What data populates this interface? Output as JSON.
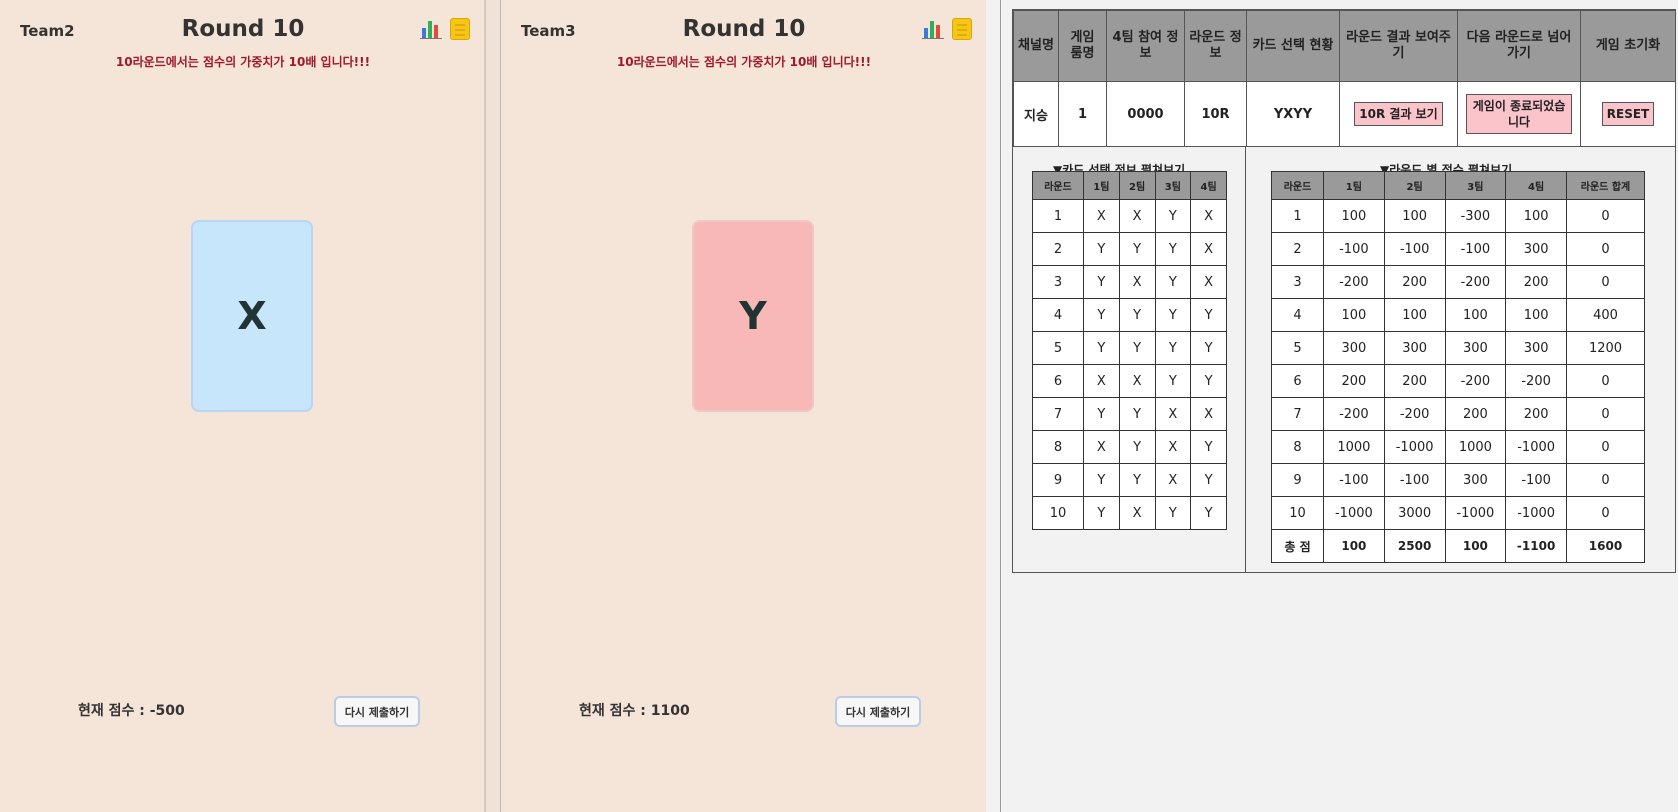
{
  "team2": {
    "name": "Team2",
    "round": "Round 10",
    "notice": "10라운드에서는 점수의 가중치가 10배 입니다!!!",
    "card": "X",
    "score": "현재 점수 : -500",
    "button": "다시 제출하기"
  },
  "team3": {
    "name": "Team3",
    "round": "Round 10",
    "notice": "10라운드에서는 점수의 가중치가 10배 입니다!!!",
    "card": "Y",
    "score": "현재 점수 : 1100",
    "button": "다시 제출하기"
  },
  "admin": {
    "headers": [
      "채널명",
      "게임 룸명",
      "4팀 참여 정보",
      "라운드 정보",
      "카드 선택 현황",
      "라운드 결과 보여주기",
      "다음 라운드로 넘어가기",
      "게임 초기화"
    ],
    "row": {
      "channel": "지승",
      "room": "1",
      "participation": "0000",
      "round": "10R",
      "cards": "YXYY",
      "show_result": "10R 결과 보기",
      "next_round": "게임이 종료되었습니다",
      "reset": "RESET"
    },
    "card_section_title": "▼카드 선택 정보 펼쳐보기",
    "score_section_title": "▼라운드 별 점수 펼쳐보기",
    "card_table": {
      "headers": [
        "라운드",
        "1팀",
        "2팀",
        "3팀",
        "4팀"
      ],
      "rows": [
        [
          "1",
          "X",
          "X",
          "Y",
          "X"
        ],
        [
          "2",
          "Y",
          "Y",
          "Y",
          "X"
        ],
        [
          "3",
          "Y",
          "X",
          "Y",
          "X"
        ],
        [
          "4",
          "Y",
          "Y",
          "Y",
          "Y"
        ],
        [
          "5",
          "Y",
          "Y",
          "Y",
          "Y"
        ],
        [
          "6",
          "X",
          "X",
          "Y",
          "Y"
        ],
        [
          "7",
          "Y",
          "Y",
          "X",
          "X"
        ],
        [
          "8",
          "X",
          "Y",
          "X",
          "Y"
        ],
        [
          "9",
          "Y",
          "Y",
          "X",
          "Y"
        ],
        [
          "10",
          "Y",
          "X",
          "Y",
          "Y"
        ]
      ]
    },
    "score_table": {
      "headers": [
        "라운드",
        "1팀",
        "2팀",
        "3팀",
        "4팀",
        "라운드 합계"
      ],
      "rows": [
        [
          "1",
          "100",
          "100",
          "-300",
          "100",
          "0"
        ],
        [
          "2",
          "-100",
          "-100",
          "-100",
          "300",
          "0"
        ],
        [
          "3",
          "-200",
          "200",
          "-200",
          "200",
          "0"
        ],
        [
          "4",
          "100",
          "100",
          "100",
          "100",
          "400"
        ],
        [
          "5",
          "300",
          "300",
          "300",
          "300",
          "1200"
        ],
        [
          "6",
          "200",
          "200",
          "-200",
          "-200",
          "0"
        ],
        [
          "7",
          "-200",
          "-200",
          "200",
          "200",
          "0"
        ],
        [
          "8",
          "1000",
          "-1000",
          "1000",
          "-1000",
          "0"
        ],
        [
          "9",
          "-100",
          "-100",
          "300",
          "-100",
          "0"
        ],
        [
          "10",
          "-1000",
          "3000",
          "-1000",
          "-1000",
          "0"
        ]
      ],
      "total": [
        "총 점",
        "100",
        "2500",
        "100",
        "-1100",
        "1600"
      ]
    }
  }
}
